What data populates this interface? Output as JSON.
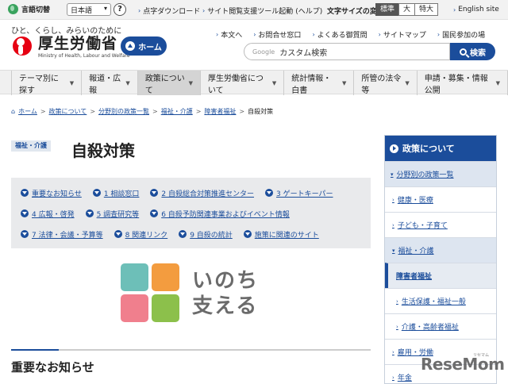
{
  "topbar": {
    "lang_toggle": "言語切替",
    "lang_value": "日本語",
    "help": "?",
    "braille": "点字ダウンロード",
    "reader": "サイト閲覧支援ツール起動",
    "reader_help": "(ヘルプ)",
    "fontsize_label": "文字サイズの変更",
    "fontsize_options": [
      "標準",
      "大",
      "特大"
    ],
    "english": "English site"
  },
  "header": {
    "tagline": "ひと、くらし、みらいのために",
    "logo_jp": "厚生労働省",
    "logo_en": "Ministry of Health, Labour and Welfare",
    "home": "ホーム",
    "links": [
      "本文へ",
      "お問合せ窓口",
      "よくある御質問",
      "サイトマップ",
      "国民参加の場"
    ],
    "search_brand": "Google",
    "search_placeholder": "カスタム検索",
    "search_button": "検索"
  },
  "gnav": [
    "テーマ別に探す",
    "報道・広報",
    "政策について",
    "厚生労働省について",
    "統計情報・白書",
    "所管の法令等",
    "申請・募集・情報公開"
  ],
  "breadcrumb": [
    "ホーム",
    "政策について",
    "分野別の政策一覧",
    "福祉・介護",
    "障害者福祉",
    "自殺対策"
  ],
  "page": {
    "category": "福祉・介護",
    "title": "自殺対策",
    "anchors": [
      [
        "重要なお知らせ",
        "1 相談窓口",
        "2 自殺総合対策推進センター",
        "3 ゲートキーパー"
      ],
      [
        "4 広報・啓発",
        "5 調査研究等",
        "6 自殺予防関連事業およびイベント情報"
      ],
      [
        "7 法律・会議・予算等",
        "8 関連リンク",
        "9 自殺の統計",
        "施策に関連のサイト"
      ]
    ],
    "banner_line1": "いのち",
    "banner_line2": "支える",
    "banner_colors": [
      "#6dbfb8",
      "#f39c3f",
      "#f07f8d",
      "#8cc04b"
    ],
    "section_title": "重要なお知らせ"
  },
  "sidebar": {
    "title": "政策について",
    "items": [
      {
        "label": "分野別の政策一覧",
        "level": "l1"
      },
      {
        "label": "健康・医療",
        "level": "l2"
      },
      {
        "label": "子ども・子育て",
        "level": "l2"
      },
      {
        "label": "福祉・介護",
        "level": "l2-open"
      },
      {
        "label": "障害者福祉",
        "level": "l3-cur"
      },
      {
        "label": "生活保護・福祉一般",
        "level": "l3"
      },
      {
        "label": "介護・高齢者福祉",
        "level": "l3"
      },
      {
        "label": "雇用・労働",
        "level": "l2"
      },
      {
        "label": "年金",
        "level": "l2"
      }
    ]
  },
  "watermark": {
    "text": "ReseMom",
    "sub": "リセマム"
  },
  "colors": {
    "brand": "#1b4d9b",
    "nav_bg": "#f0f0f0",
    "anchor_bg": "#e9eaec"
  }
}
